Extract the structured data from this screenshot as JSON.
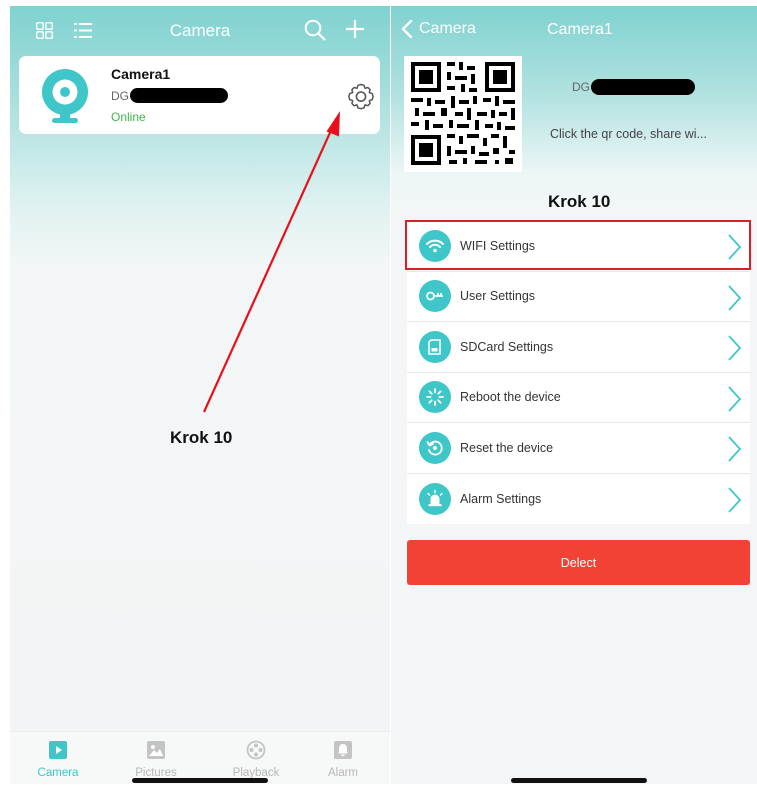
{
  "left_screen": {
    "header": {
      "title": "Camera",
      "icons": [
        "grid-view-icon",
        "list-view-icon",
        "search-icon",
        "plus-icon"
      ]
    },
    "camera_card": {
      "name": "Camera1",
      "id_prefix": "DG",
      "status": "Online",
      "status_color": "#3fb34f"
    },
    "annotation": "Krok 10",
    "tabs": [
      {
        "label": "Camera",
        "icon": "video-play-icon",
        "active": true
      },
      {
        "label": "Pictures",
        "icon": "picture-icon",
        "active": false
      },
      {
        "label": "Playback",
        "icon": "film-reel-icon",
        "active": false
      },
      {
        "label": "Alarm",
        "icon": "bell-icon",
        "active": false
      }
    ]
  },
  "right_screen": {
    "header": {
      "back_label": "Camera",
      "title": "Camera1"
    },
    "device_id_prefix": "DG",
    "qr_hint": "Click the qr code, share wi...",
    "annotation": "Krok 10",
    "menu": [
      {
        "label": "WIFI Settings",
        "icon": "wifi-icon"
      },
      {
        "label": "User Settings",
        "icon": "key-icon"
      },
      {
        "label": "SDCard Settings",
        "icon": "sdcard-icon"
      },
      {
        "label": "Reboot the device",
        "icon": "reboot-icon"
      },
      {
        "label": "Reset the device",
        "icon": "reset-icon"
      },
      {
        "label": "Alarm Settings",
        "icon": "alarm-siren-icon"
      }
    ],
    "delete_label": "Delect"
  },
  "colors": {
    "accent": "#3ec6c9",
    "header_teal": "#7fd2d0",
    "delete_red": "#f24236",
    "highlight_red": "#e21c24",
    "annotation_arrow": "#e8101a"
  }
}
